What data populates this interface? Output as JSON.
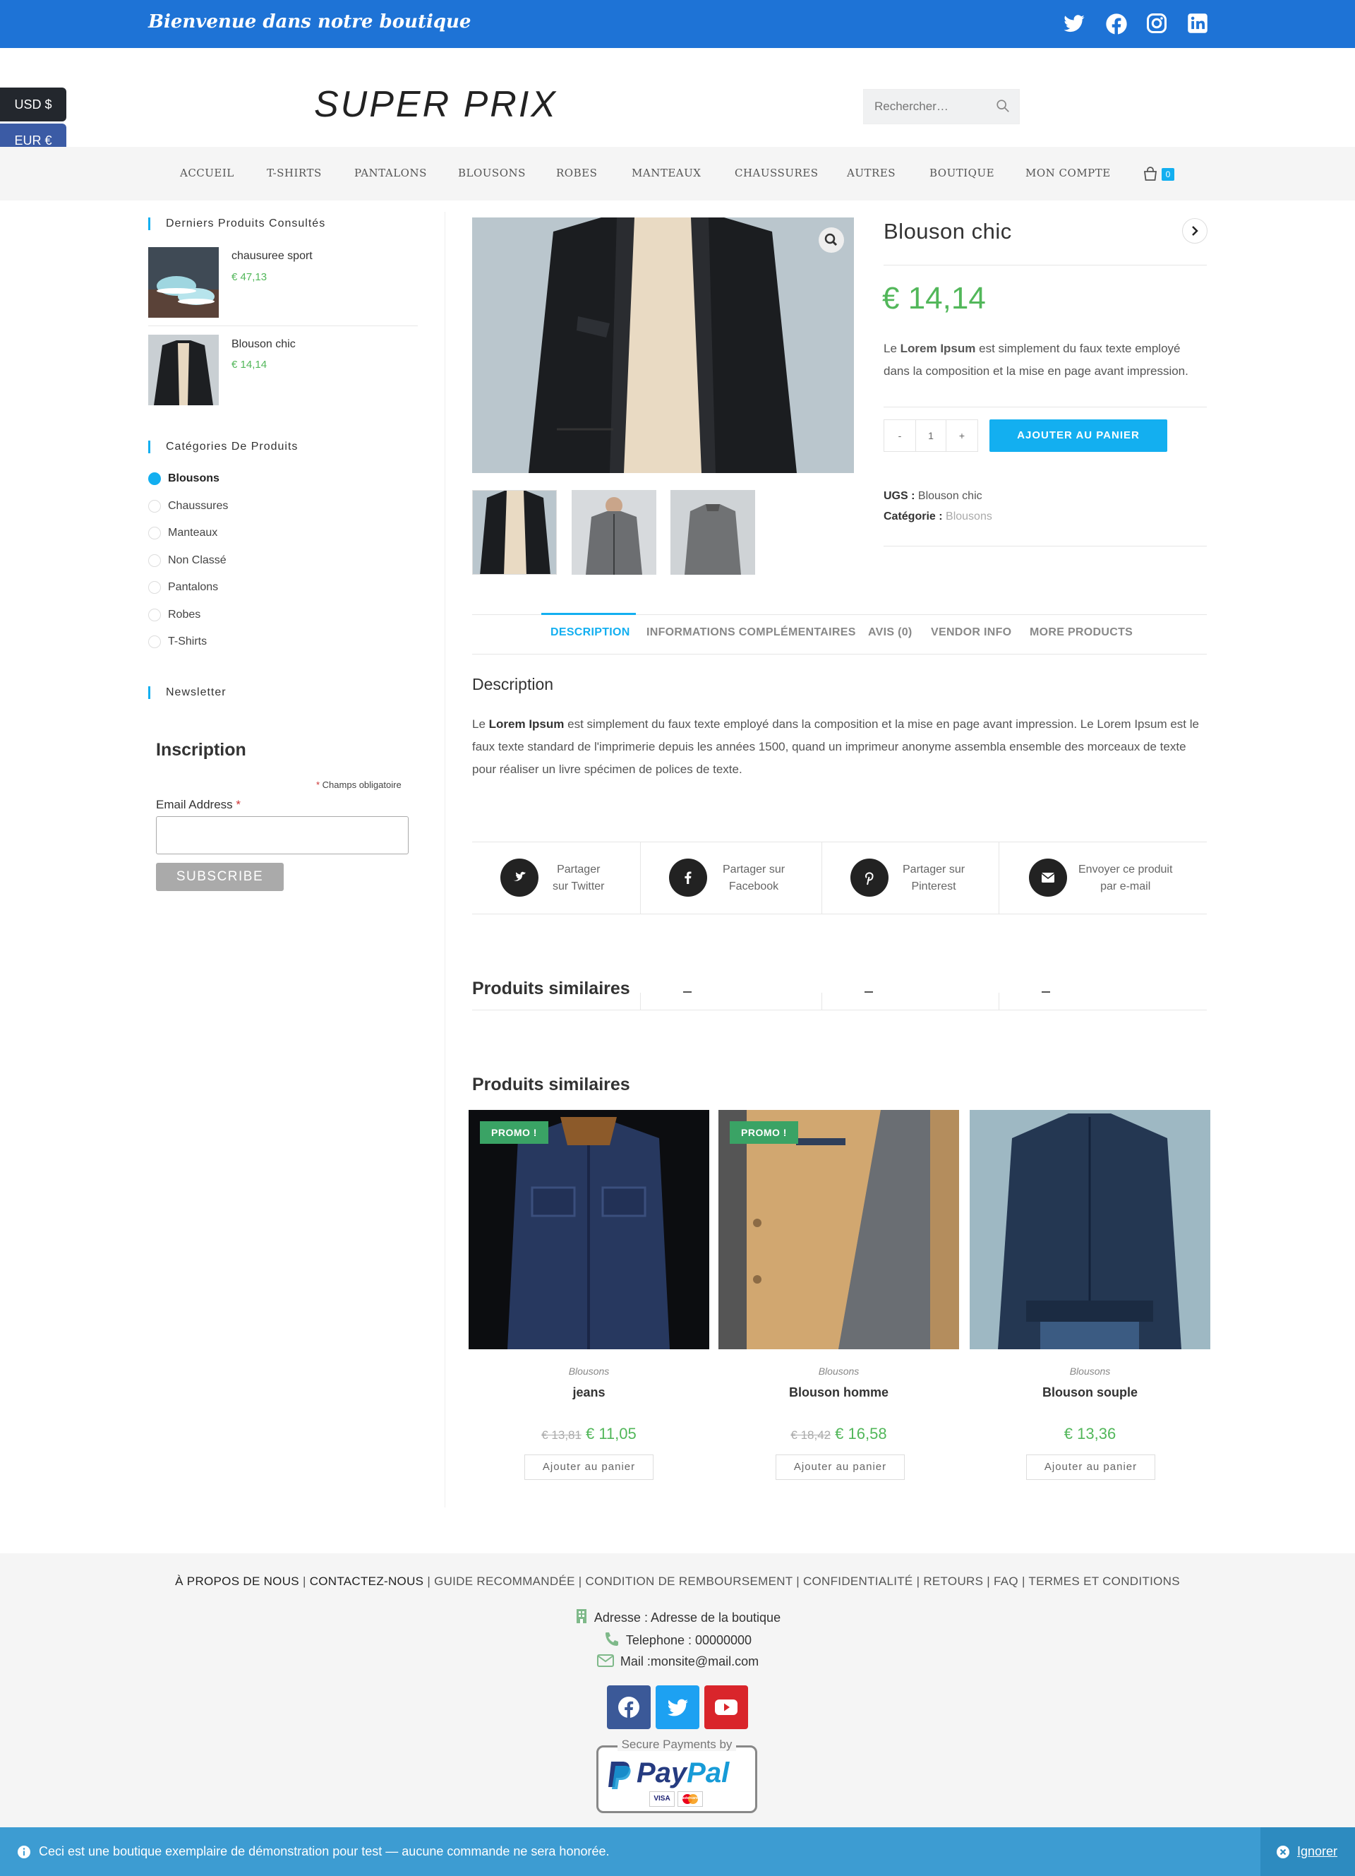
{
  "topbar": {
    "welcome": "Bienvenue dans notre boutique",
    "social_icons": [
      "twitter-icon",
      "facebook-icon",
      "instagram-icon",
      "linkedin-icon"
    ]
  },
  "currency": {
    "usd": "USD $",
    "eur": "EUR €"
  },
  "header": {
    "logo": "SUPER PRIX",
    "search_placeholder": "Rechercher…"
  },
  "nav": {
    "items": [
      "ACCUEIL",
      "T-SHIRTS",
      "PANTALONS",
      "BLOUSONS",
      "ROBES",
      "MANTEAUX",
      "CHAUSSURES",
      "AUTRES",
      "BOUTIQUE",
      "MON COMPTE"
    ],
    "cart_count": "0"
  },
  "sidebar": {
    "recent_title": "Derniers Produits Consultés",
    "recent": [
      {
        "name": "chausuree sport",
        "price": "€ 47,13"
      },
      {
        "name": "Blouson chic",
        "price": "€ 14,14"
      }
    ],
    "categories_title": "Catégories De Produits",
    "categories": [
      "Blousons",
      "Chaussures",
      "Manteaux",
      "Non Classé",
      "Pantalons",
      "Robes",
      "T-Shirts"
    ],
    "newsletter_title": "Newsletter",
    "inscription": "Inscription",
    "required_note": "Champs obligatoire",
    "email_label": "Email Address",
    "subscribe": "SUBSCRIBE"
  },
  "product": {
    "title": "Blouson chic",
    "price": "€ 14,14",
    "short_desc_pre": "Le ",
    "short_desc_bold": "Lorem Ipsum",
    "short_desc_post": " est simplement du faux texte employé dans la composition et la mise en page avant impression.",
    "qty_minus": "-",
    "qty": "1",
    "qty_plus": "+",
    "add_to_cart": "AJOUTER AU PANIER",
    "sku_label": "UGS :",
    "sku": "Blouson chic",
    "category_label": "Catégorie :",
    "category": "Blousons"
  },
  "tabs": [
    "DESCRIPTION",
    "INFORMATIONS COMPLÉMENTAIRES",
    "AVIS (0)",
    "VENDOR INFO",
    "MORE PRODUCTS"
  ],
  "description": {
    "title": "Description",
    "pre": "Le ",
    "bold": "Lorem Ipsum",
    "post": " est simplement du faux texte employé dans la composition et la mise en page avant impression. Le Lorem Ipsum est le faux texte standard de l'imprimerie depuis les années 1500, quand un imprimeur anonyme assembla ensemble des morceaux de texte pour réaliser un livre spécimen de polices de texte."
  },
  "share": [
    {
      "line1": "Partager",
      "line2": "sur Twitter",
      "icon": "twitter-icon"
    },
    {
      "line1": "Partager sur",
      "line2": "Facebook",
      "icon": "facebook-icon"
    },
    {
      "line1": "Partager sur",
      "line2": "Pinterest",
      "icon": "pinterest-icon"
    },
    {
      "line1": "Envoyer ce produit",
      "line2": "par e-mail",
      "icon": "mail-icon"
    }
  ],
  "related": {
    "title_ghost": "Produits similaires",
    "title": "Produits similaires",
    "promo": "PROMO !",
    "add_btn": "Ajouter au panier",
    "items": [
      {
        "cat": "Blousons",
        "name": "jeans",
        "old": "€ 13,81",
        "price": "€ 11,05"
      },
      {
        "cat": "Blousons",
        "name": "Blouson homme",
        "old": "€ 18,42",
        "price": "€ 16,58"
      },
      {
        "cat": "Blousons",
        "name": "Blouson souple",
        "old": "",
        "price": "€ 13,36"
      }
    ]
  },
  "footer": {
    "links": [
      "À PROPOS DE NOUS",
      "CONTACTEZ-NOUS",
      "GUIDE RECOMMANDÉE",
      "CONDITION DE REMBOURSEMENT",
      "CONFIDENTIALITÉ",
      "RETOURS",
      "FAQ",
      "TERMES ET CONDITIONS"
    ],
    "address": "Adresse : Adresse de la boutique",
    "phone": "Telephone : 00000000",
    "mail": "Mail :monsite@mail.com",
    "paypal_caption": "Secure Payments by",
    "paypal_brand_1": "Pay",
    "paypal_brand_2": "Pal",
    "cards": [
      "VISA",
      "mastercard"
    ]
  },
  "notice": {
    "message": "Ceci est une boutique exemplaire de démonstration pour test — aucune commande ne sera honorée.",
    "dismiss": "Ignorer"
  },
  "colors": {
    "topbar": "#1e73d6",
    "accent": "#13aff0",
    "price": "#52b75a",
    "promo": "#3aa365",
    "notice": "#3d9cd2"
  }
}
